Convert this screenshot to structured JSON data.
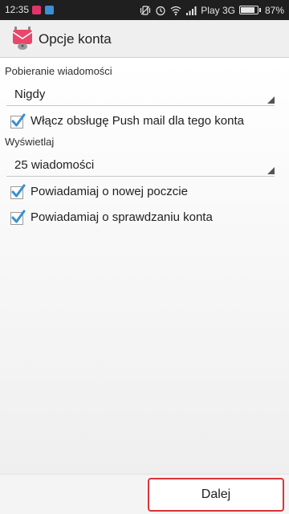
{
  "status_bar": {
    "time": "12:35",
    "carrier": "Play 3G",
    "battery_text": "87%",
    "battery_level": 0.87,
    "icons": [
      "app-notification-icon",
      "message-notification-icon",
      "vibrate-icon",
      "alarm-icon",
      "wifi-icon",
      "signal-icon",
      "battery-icon"
    ]
  },
  "action_bar": {
    "title": "Opcje konta",
    "icon": "k9-mail-app-icon"
  },
  "form": {
    "fetch_label": "Pobieranie wiadomości",
    "fetch_value": "Nigdy",
    "push_label": "Włącz obsługę Push mail dla tego konta",
    "push_checked": true,
    "display_label": "Wyświetlaj",
    "display_value": "25 wiadomości",
    "notify_new_label": "Powiadamiaj o nowej poczcie",
    "notify_new_checked": true,
    "notify_check_label": "Powiadamiaj o sprawdzaniu konta",
    "notify_check_checked": true
  },
  "footer": {
    "next_label": "Dalej"
  },
  "colors": {
    "accent_red": "#d9343a",
    "check_blue": "#3a8fd0",
    "statusbar_bg": "#1f1f1f"
  }
}
